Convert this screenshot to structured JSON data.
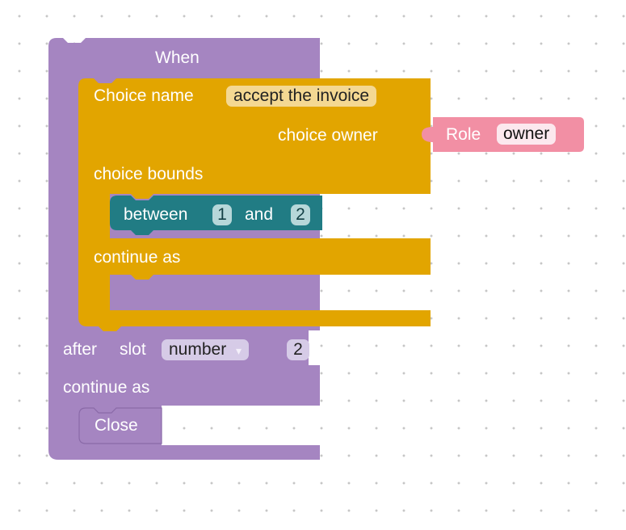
{
  "when_block": {
    "label": "When",
    "after_label": "after",
    "slot_label": "slot",
    "slot_dropdown": {
      "value": "number",
      "arrow": "▾"
    },
    "slot_value": "2",
    "continue_label": "continue as",
    "close_label": "Close",
    "color": "#a585c1"
  },
  "choice_block": {
    "name_label": "Choice name",
    "name_value": "accept the invoice",
    "owner_label": "choice owner",
    "bounds_label": "choice bounds",
    "continue_label": "continue as",
    "color": "#e2a500"
  },
  "between_block": {
    "label": "between",
    "min": "1",
    "and_label": "and",
    "max": "2",
    "color": "#217c84"
  },
  "role_block": {
    "label": "Role",
    "value": "owner",
    "color": "#f28fa4"
  }
}
